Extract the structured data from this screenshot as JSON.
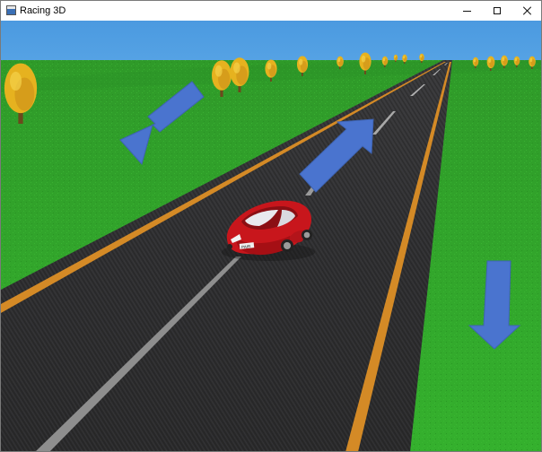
{
  "window": {
    "title": "Racing 3D",
    "icon": "app-window-icon",
    "controls": [
      "minimize-icon",
      "maximize-icon",
      "close-icon"
    ]
  },
  "scene": {
    "sky_color": "#4f9ee0",
    "grass_color": "#2fa52a",
    "road_color": "#2f2f31",
    "edge_line_color": "#d48a26",
    "center_line_color": "#8d8d8d",
    "tree_foliage_color": "#e6b21f",
    "car_color": "#c8161c",
    "arrow_color": "#4a74cf",
    "car_plate": "PAIR",
    "arrows": [
      "left-arrow",
      "forward-arrow",
      "down-arrow"
    ]
  }
}
